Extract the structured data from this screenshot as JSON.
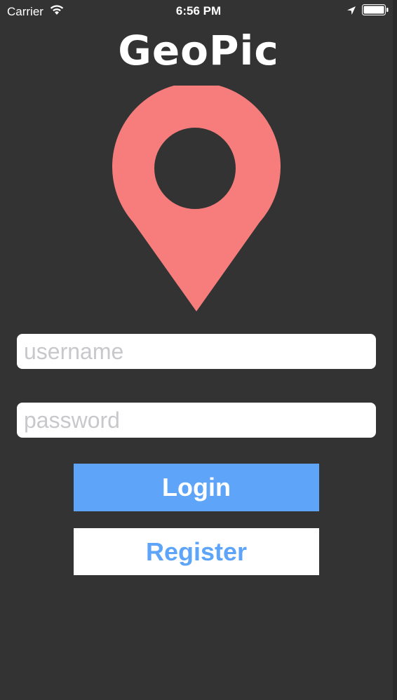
{
  "status_bar": {
    "carrier": "Carrier",
    "time": "6:56 PM",
    "wifi_icon": "wifi-icon",
    "location_icon": "location-arrow-icon",
    "battery_icon": "battery-icon"
  },
  "app": {
    "title": "GeoPic",
    "logo_icon": "map-pin-icon"
  },
  "form": {
    "username": {
      "value": "",
      "placeholder": "username"
    },
    "password": {
      "value": "",
      "placeholder": "password"
    },
    "login_label": "Login",
    "register_label": "Register"
  },
  "colors": {
    "background": "#333333",
    "pin": "#f77d7d",
    "accent": "#5ea5fa",
    "placeholder": "#c8c8cc"
  }
}
